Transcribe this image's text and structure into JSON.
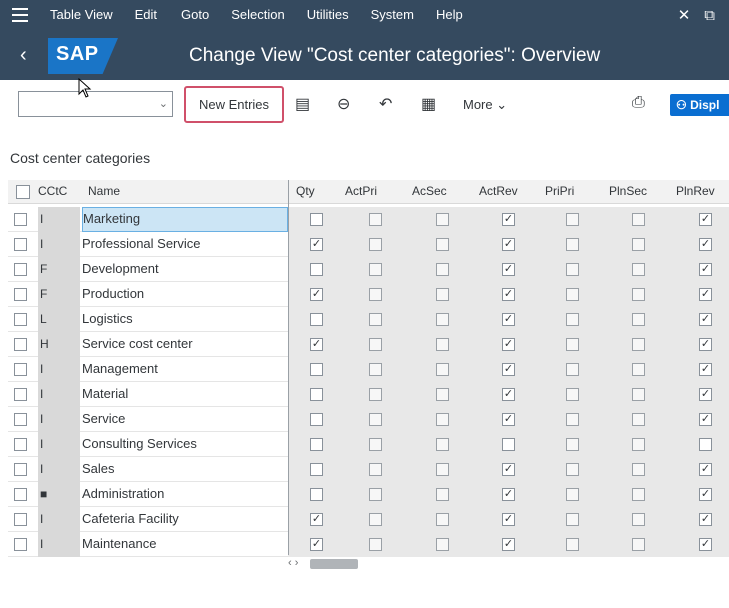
{
  "menu": {
    "items": [
      "Table View",
      "Edit",
      "Goto",
      "Selection",
      "Utilities",
      "System",
      "Help"
    ]
  },
  "title": {
    "logo": "SAP",
    "page_title": "Change View \"Cost center categories\": Overview"
  },
  "toolbar": {
    "command_field_value": "",
    "new_entries_label": "New Entries",
    "more_label": "More",
    "display_label": "Displ"
  },
  "section": {
    "title": "Cost center categories"
  },
  "table": {
    "headers": {
      "cctc": "CCtC",
      "name": "Name",
      "qty": "Qty",
      "actpri": "ActPri",
      "acsec": "AcSec",
      "actrev": "ActRev",
      "pripri": "PriPri",
      "plnsec": "PlnSec",
      "plnrev": "PlnRev"
    },
    "rows": [
      {
        "cctc": "I",
        "name": "Marketing",
        "qty": false,
        "actpri": false,
        "acsec": false,
        "actrev": true,
        "pripri": false,
        "plnsec": false,
        "plnrev": true
      },
      {
        "cctc": "I",
        "name": "Professional Service",
        "qty": true,
        "actpri": false,
        "acsec": false,
        "actrev": true,
        "pripri": false,
        "plnsec": false,
        "plnrev": true
      },
      {
        "cctc": "F",
        "name": "Development",
        "qty": false,
        "actpri": false,
        "acsec": false,
        "actrev": true,
        "pripri": false,
        "plnsec": false,
        "plnrev": true
      },
      {
        "cctc": "F",
        "name": "Production",
        "qty": true,
        "actpri": false,
        "acsec": false,
        "actrev": true,
        "pripri": false,
        "plnsec": false,
        "plnrev": true
      },
      {
        "cctc": "L",
        "name": "Logistics",
        "qty": false,
        "actpri": false,
        "acsec": false,
        "actrev": true,
        "pripri": false,
        "plnsec": false,
        "plnrev": true
      },
      {
        "cctc": "H",
        "name": "Service cost center",
        "qty": true,
        "actpri": false,
        "acsec": false,
        "actrev": true,
        "pripri": false,
        "plnsec": false,
        "plnrev": true
      },
      {
        "cctc": "I",
        "name": "Management",
        "qty": false,
        "actpri": false,
        "acsec": false,
        "actrev": true,
        "pripri": false,
        "plnsec": false,
        "plnrev": true
      },
      {
        "cctc": "I",
        "name": "Material",
        "qty": false,
        "actpri": false,
        "acsec": false,
        "actrev": true,
        "pripri": false,
        "plnsec": false,
        "plnrev": true
      },
      {
        "cctc": "I",
        "name": "Service",
        "qty": false,
        "actpri": false,
        "acsec": false,
        "actrev": true,
        "pripri": false,
        "plnsec": false,
        "plnrev": true
      },
      {
        "cctc": "I",
        "name": "Consulting Services",
        "qty": false,
        "actpri": false,
        "acsec": false,
        "actrev": false,
        "pripri": false,
        "plnsec": false,
        "plnrev": false
      },
      {
        "cctc": "I",
        "name": "Sales",
        "qty": false,
        "actpri": false,
        "acsec": false,
        "actrev": true,
        "pripri": false,
        "plnsec": false,
        "plnrev": true
      },
      {
        "cctc": "■",
        "name": "Administration",
        "qty": false,
        "actpri": false,
        "acsec": false,
        "actrev": true,
        "pripri": false,
        "plnsec": false,
        "plnrev": true
      },
      {
        "cctc": "I",
        "name": "Cafeteria Facility",
        "qty": true,
        "actpri": false,
        "acsec": false,
        "actrev": true,
        "pripri": false,
        "plnsec": false,
        "plnrev": true
      },
      {
        "cctc": "I",
        "name": "Maintenance",
        "qty": true,
        "actpri": false,
        "acsec": false,
        "actrev": true,
        "pripri": false,
        "plnsec": false,
        "plnrev": true
      }
    ]
  },
  "icons": {
    "check": "✓"
  }
}
